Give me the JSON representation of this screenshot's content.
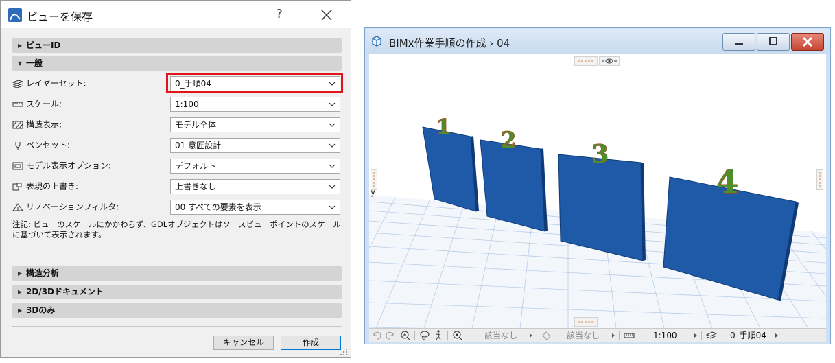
{
  "dialog": {
    "title": "ビューを保存",
    "help": "?",
    "sections": {
      "view_id": "ビューID",
      "general": "一般",
      "structural_analysis": "構造分析",
      "doc_2d3d": "2D/3Dドキュメント",
      "only_3d": "3Dのみ"
    },
    "rows": [
      {
        "label": "レイヤーセット:",
        "value": "0_手順04"
      },
      {
        "label": "スケール:",
        "value": "1:100"
      },
      {
        "label": "構造表示:",
        "value": "モデル全体"
      },
      {
        "label": "ペンセット:",
        "value": "01 意匠設計"
      },
      {
        "label": "モデル表示オプション:",
        "value": "デフォルト"
      },
      {
        "label": "表現の上書き:",
        "value": "上書きなし"
      },
      {
        "label": "リノベーションフィルタ:",
        "value": "00 すべての要素を表示"
      }
    ],
    "note": "注記: ビューのスケールにかかわらず、GDLオブジェクトはソースビューポイントのスケールに基づいて表示されます。",
    "buttons": {
      "cancel": "キャンセル",
      "create": "作成"
    },
    "highlight_color": "#e0151b"
  },
  "window3d": {
    "title": "BIMx作業手順の作成 › 04",
    "axis_label": "y",
    "panel_numbers": [
      "1",
      "2",
      "3",
      "4"
    ],
    "panel_color": "#1e5aa8",
    "status": {
      "not_applicable_1": "該当なし",
      "not_applicable_2": "該当なし",
      "scale": "1:100",
      "layer_set": "0_手順04"
    }
  }
}
